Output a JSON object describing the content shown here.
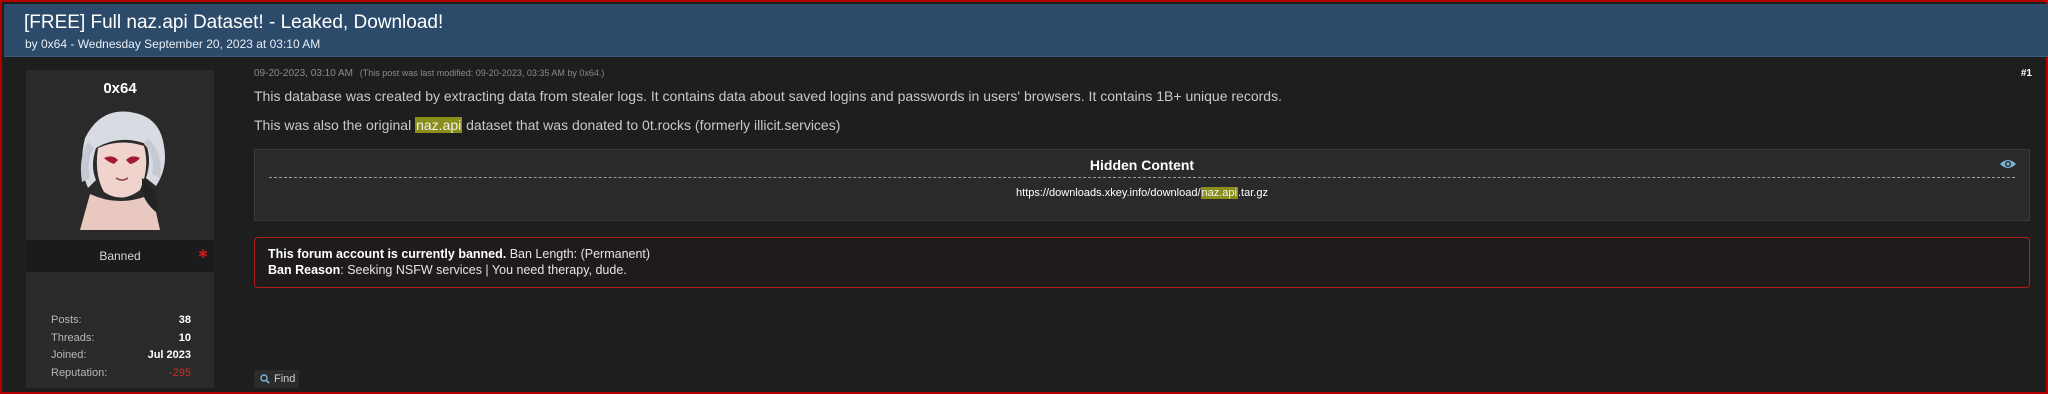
{
  "thread": {
    "title": "[FREE] Full naz.api Dataset! - Leaked, Download!",
    "byline": "by 0x64 - Wednesday September 20, 2023 at 03:10 AM"
  },
  "author": {
    "username": "0x64",
    "usertitle": "Banned",
    "stats": [
      {
        "label": "Posts:",
        "value": "38"
      },
      {
        "label": "Threads:",
        "value": "10"
      },
      {
        "label": "Joined:",
        "value": "Jul 2023"
      },
      {
        "label": "Reputation:",
        "value": "-295"
      }
    ]
  },
  "post": {
    "date": "09-20-2023, 03:10 AM",
    "edited": "(This post was last modified: 09-20-2023, 03:35 AM by 0x64.)",
    "number": "#1",
    "para1": "This database was created by extracting data from stealer logs. It contains data about saved logins and passwords in users' browsers. It contains 1B+ unique records.",
    "para2_before": "This was also the original ",
    "para2_highlight": "naz.api",
    "para2_after": " dataset that was donated to 0t.rocks (formerly illicit.services)",
    "hidden": {
      "title": "Hidden Content",
      "link_before": "https://downloads.xkey.info/download/",
      "link_highlight": "naz.api",
      "link_after": ".tar.gz",
      "icon": "eye-icon"
    },
    "ban": {
      "notice_bold": "This forum account is currently banned.",
      "notice_rest": " Ban Length: (Permanent)",
      "reason_label": "Ban Reason",
      "reason_text": ": Seeking NSFW services | You need therapy, dude."
    },
    "find_label": "Find"
  },
  "colors": {
    "header": "#2c4a6a",
    "highlight": "#8a8f1c",
    "ban_border": "#b01e1e",
    "negative_rep": "#cf2b2b"
  }
}
